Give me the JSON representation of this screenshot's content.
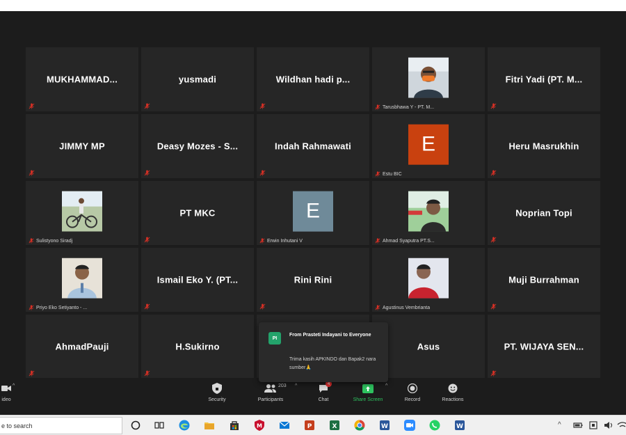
{
  "participants": [
    {
      "name": "MUKHAMMAD...",
      "type": "name"
    },
    {
      "name": "yusmadi",
      "type": "name"
    },
    {
      "name": "Wildhan  hadi  p...",
      "type": "name"
    },
    {
      "caption": "Tarusbhawa Y - PT. M...",
      "type": "photo",
      "photo": "man-orange-mask"
    },
    {
      "name": "Fitri Yadi (PT. M...",
      "type": "name"
    },
    {
      "name": "JIMMY MP",
      "type": "name"
    },
    {
      "name": "Deasy Mozes - S...",
      "type": "name"
    },
    {
      "name": "Indah Rahmawati",
      "type": "name"
    },
    {
      "caption": "Estu BIC",
      "type": "letter",
      "letter": "E",
      "color": "#c9410f"
    },
    {
      "name": "Heru Masrukhin",
      "type": "name"
    },
    {
      "caption": "Sulistyono Siradj",
      "type": "photo",
      "photo": "cyclist"
    },
    {
      "name": "PT MKC",
      "type": "name"
    },
    {
      "caption": "Erwin Inhutani V",
      "type": "letter",
      "letter": "E",
      "color": "#6f8a99"
    },
    {
      "caption": "Ahmad Syaputra PT.S...",
      "type": "photo",
      "photo": "young-man"
    },
    {
      "name": "Noprian Topi",
      "type": "name"
    },
    {
      "caption": "Priyo Eko Setiyanto - ...",
      "type": "photo",
      "photo": "man-office"
    },
    {
      "name": "Ismail Eko Y. (PT...",
      "type": "name"
    },
    {
      "name": "Rini Rini",
      "type": "name"
    },
    {
      "caption": "Agustinus Vembrianta",
      "type": "photo",
      "photo": "man-red"
    },
    {
      "name": "Muji Burrahman",
      "type": "name"
    },
    {
      "name": "AhmadPauji",
      "type": "name"
    },
    {
      "name": "H.Sukirno",
      "type": "name"
    },
    {
      "name": "",
      "type": "hidden"
    },
    {
      "name": "Asus",
      "type": "name"
    },
    {
      "name": "PT. WIJAYA SEN...",
      "type": "name"
    }
  ],
  "chat": {
    "avatar": "PI",
    "from": "From Prasteti Indayani to Everyone",
    "message": "Trima kasih APKINDO dan Bapak2 nara sumber🙏"
  },
  "toolbar": {
    "video_label": "ideo",
    "security_label": "Security",
    "participants_label": "Participants",
    "participants_count": "203",
    "chat_label": "Chat",
    "chat_badge": "4",
    "share_label": "Share Screen",
    "record_label": "Record",
    "reactions_label": "Reactions"
  },
  "taskbar": {
    "search_text": "e to search"
  },
  "colors": {
    "meeting_bg": "#1c1c1c",
    "tile_bg": "#262626",
    "share_green": "#2ec25f",
    "muted_red": "#d93025"
  }
}
